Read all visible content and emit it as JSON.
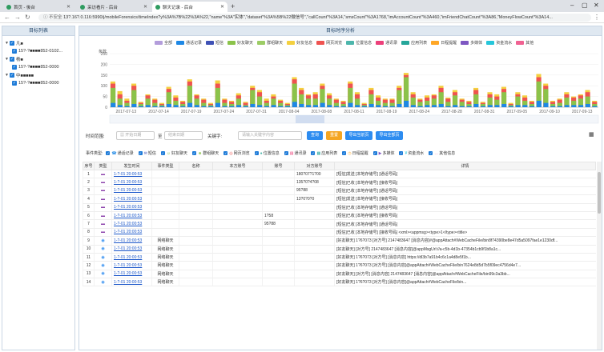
{
  "tabs": [
    {
      "title": "首页 - 後台"
    },
    {
      "title": "采访看片 - 后台"
    },
    {
      "title": "聊天记录 - 后台"
    }
  ],
  "url": "13?.16?.0.116:5990/j/mobileForensics/timeIndex?y%3A%7B%22%3A%22,\"name\"%3A\"实体\",\"dataset\"%3A%5B%22微信号”,\"callCount\"%3A14,\"smsCount\"%3A1768,\"imAccountCount\"%3A460,\"imFriendChatCount\"%3A86,\"MoneyFlowCount\"%3A14...",
  "addr_warn": "不安全",
  "sidebar": {
    "title": "目标列表",
    "items": [
      {
        "label": "凡■",
        "toggle": "▼"
      },
      {
        "label": "15?-?■■■■852-0102..."
      },
      {
        "label": "杨■",
        "toggle": "▼"
      },
      {
        "label": "15?-?■■■■852-0000"
      },
      {
        "label": "中■■■■■",
        "toggle": "▼"
      },
      {
        "label": "15?-?■■■■852-0000"
      }
    ]
  },
  "main": {
    "title": "目标时序分析"
  },
  "legend": [
    {
      "label": "全部",
      "color": "#b39ddb"
    },
    {
      "label": "通话记录",
      "color": "#1e88e5"
    },
    {
      "label": "短信",
      "color": "#3f51b5"
    },
    {
      "label": "好友聊天",
      "color": "#8bc34a"
    },
    {
      "label": "群组聊天",
      "color": "#9ccc65"
    },
    {
      "label": "好友信息",
      "color": "#f4d03f"
    },
    {
      "label": "网页浏览",
      "color": "#ef5350"
    },
    {
      "label": "位置信息",
      "color": "#4db6ac"
    },
    {
      "label": "通讯录",
      "color": "#ec407a"
    },
    {
      "label": "应用列表",
      "color": "#26a69a"
    },
    {
      "label": "日程提醒",
      "color": "#ffa726"
    },
    {
      "label": "多媒体",
      "color": "#7e57c2"
    },
    {
      "label": "资金流水",
      "color": "#26c6da"
    },
    {
      "label": "其他",
      "color": "#f06292"
    }
  ],
  "chart_data": {
    "type": "bar",
    "ylabel": "条数",
    "yticks": [
      0,
      50,
      100,
      150,
      200,
      250
    ],
    "ylim": [
      0,
      250
    ],
    "xticks": [
      "2017-07-13",
      "2017-07-14",
      "2017-07-19",
      "2017-07-24",
      "2017-07-31",
      "2017-08-04",
      "2017-08-08",
      "2017-08-11",
      "2017-08-19",
      "2017-08-24",
      "2017-08-28",
      "2017-08-31",
      "2017-09-05",
      "2017-09-10",
      "2017-09-13"
    ],
    "series": [
      {
        "color": "#f4d03f",
        "values": [
          120,
          75,
          40,
          110,
          25,
          60,
          40,
          20,
          95,
          55,
          30,
          130,
          60,
          40,
          20,
          125,
          40,
          30,
          65,
          25,
          100,
          80,
          40,
          60,
          35,
          20,
          140,
          90,
          60,
          70,
          110,
          65,
          40,
          30,
          120,
          70,
          20,
          90,
          55,
          40,
          40,
          100,
          160,
          70,
          40,
          55,
          60,
          100,
          45,
          80,
          40,
          30,
          90,
          25,
          70,
          60,
          95,
          20,
          70,
          55,
          30,
          155,
          110,
          30,
          40,
          70,
          50,
          60,
          80,
          30
        ]
      },
      {
        "color": "#ef5350",
        "values": [
          110,
          60,
          30,
          100,
          20,
          55,
          35,
          15,
          85,
          45,
          25,
          120,
          55,
          35,
          15,
          110,
          35,
          25,
          55,
          20,
          90,
          70,
          30,
          50,
          30,
          15,
          130,
          80,
          55,
          60,
          100,
          55,
          35,
          25,
          110,
          60,
          15,
          80,
          45,
          35,
          35,
          90,
          150,
          60,
          35,
          45,
          55,
          90,
          40,
          70,
          35,
          25,
          80,
          20,
          60,
          50,
          85,
          15,
          60,
          45,
          25,
          140,
          100,
          25,
          35,
          60,
          45,
          55,
          70,
          25
        ]
      },
      {
        "color": "#8bc34a",
        "values": [
          90,
          40,
          20,
          80,
          15,
          40,
          20,
          10,
          70,
          30,
          15,
          100,
          40,
          20,
          10,
          90,
          20,
          15,
          40,
          10,
          80,
          50,
          20,
          40,
          20,
          10,
          110,
          60,
          40,
          40,
          85,
          40,
          20,
          15,
          90,
          40,
          10,
          60,
          30,
          20,
          20,
          80,
          140,
          45,
          25,
          30,
          40,
          70,
          25,
          55,
          25,
          15,
          60,
          15,
          45,
          35,
          70,
          10,
          50,
          30,
          15,
          120,
          85,
          15,
          20,
          45,
          30,
          40,
          50,
          15
        ]
      },
      {
        "color": "#1e88e5",
        "values": [
          20,
          10,
          5,
          15,
          5,
          10,
          5,
          5,
          15,
          10,
          5,
          20,
          10,
          5,
          5,
          20,
          5,
          5,
          10,
          5,
          15,
          10,
          5,
          10,
          5,
          5,
          25,
          15,
          10,
          10,
          20,
          10,
          5,
          5,
          20,
          10,
          5,
          15,
          10,
          5,
          5,
          15,
          30,
          10,
          5,
          10,
          10,
          15,
          5,
          10,
          5,
          5,
          15,
          5,
          10,
          10,
          15,
          5,
          10,
          10,
          5,
          30,
          20,
          5,
          5,
          10,
          10,
          10,
          15,
          5
        ]
      }
    ]
  },
  "filters": {
    "time_label": "时间范围:",
    "start_placeholder": "开始日期",
    "sep": "至",
    "end_placeholder": "结束日期",
    "keyword_label": "关键字:",
    "keyword_placeholder": "请输入关键字内容",
    "btn_search": "查询",
    "btn_reset": "重置",
    "btn_export": "导出当前页",
    "btn_export_all": "导出全部页"
  },
  "types_label": "事件类型:",
  "types": [
    {
      "label": "通话记录",
      "icon": "☎",
      "color": "#1e88e5"
    },
    {
      "label": "短信",
      "icon": "✉",
      "color": "#3f51b5"
    },
    {
      "label": "好友聊天",
      "icon": "☺",
      "color": "#8bc34a"
    },
    {
      "label": "群组聊天",
      "icon": "☻",
      "color": "#9ccc65"
    },
    {
      "label": "网页浏览",
      "icon": "◎",
      "color": "#ef5350"
    },
    {
      "label": "位置信息",
      "icon": "●",
      "color": "#4db6ac"
    },
    {
      "label": "通讯录",
      "icon": "▤",
      "color": "#ec407a"
    },
    {
      "label": "应用列表",
      "icon": "▦",
      "color": "#26a69a"
    },
    {
      "label": "日程提醒",
      "icon": "◷",
      "color": "#ffa726"
    },
    {
      "label": "多媒体",
      "icon": "▶",
      "color": "#7e57c2"
    },
    {
      "label": "资金流水",
      "icon": "¥",
      "color": "#26c6da"
    },
    {
      "label": "其他信息",
      "icon": "…",
      "color": "#f06292"
    }
  ],
  "table": {
    "headers": [
      "序号",
      "类型",
      "发生时间",
      "事件类型",
      "名称",
      "本方账号",
      "账号",
      "对方账号",
      "详情"
    ],
    "rows": [
      [
        "1",
        "msg",
        "1-?-01 20:00:53",
        "",
        "",
        "",
        "",
        "180?07?1?00",
        "[短信]发送 [本地存储号] [通话号码]"
      ],
      [
        "2",
        "msg",
        "1-?-01 20:00:53",
        "",
        "",
        "",
        "",
        "135?0?4?08",
        "[短信]已收 [本地存储号] [接收号码]"
      ],
      [
        "3",
        "msg",
        "1-?-01 20:00:53",
        "",
        "",
        "",
        "",
        "95?88",
        "[短信]已收 [本地存储号] [通话号码]"
      ],
      [
        "4",
        "msg",
        "1-?-01 20:00:53",
        "",
        "",
        "",
        "",
        "13?0?0?0",
        "[短信]发送 [本地存储号] [接收号码]"
      ],
      [
        "5",
        "msg",
        "1-?-01 20:00:53",
        "",
        "",
        "",
        "",
        "",
        "[短信]已收 [本地存储号] [通话号码]"
      ],
      [
        "6",
        "msg",
        "1-?-01 20:00:53",
        "",
        "",
        "",
        "1?58",
        "",
        "[短信]已收 [本地存储号] [接收号码]"
      ],
      [
        "7",
        "msg",
        "1-?-01 20:00:53",
        "",
        "",
        "",
        "95?88",
        "",
        "[短信]已收 [本地存储号] [通话号码]"
      ],
      [
        "8",
        "msg",
        "1-?-01 20:00:53",
        "",
        "",
        "",
        "",
        "",
        "[短信]已收 [本地存储号] [接收号码] <xml><appmsg><type>1</type><title>"
      ],
      [
        "9",
        "chat",
        "1-?-01 20:00:53",
        "网络聊天",
        "",
        "",
        "",
        "",
        "[好友聊天] 1?6?073 [对方号] 2147483647 [消息内容]#@appAttach#WebCacheFile/bin8f74390be8e47d5a5097fae1e1230df..."
      ],
      [
        "10",
        "chat",
        "1-?-01 20:00:53",
        "网络聊天",
        "",
        "",
        "",
        "",
        "[好友聊天] [对方号] 2147483647 [消息内容]@appMsgUrl://a-c5b-4d1b-47354b1cb9f1b8a1c..."
      ],
      [
        "11",
        "chat",
        "1-?-01 20:00:53",
        "网络聊天",
        "",
        "",
        "",
        "",
        "[好友聊天] 1?6?073 [对方号] [消息内容] https://dl3b7a91b4c6c1a4d8e5f1b..."
      ],
      [
        "12",
        "chat",
        "1-?-01 20:00:53",
        "网络聊天",
        "",
        "",
        "",
        "",
        "[好友聊天] 1?6?073 [对方号] [消息内容]@appAttach#WebCacheFile/bin7624e8d5d7b5f09ec4756d4e7..."
      ],
      [
        "13",
        "chat",
        "1-?-01 20:00:53",
        "网络聊天",
        "",
        "",
        "",
        "",
        "[好友聊天] [对方号] [消息内容] 2147483647 [消息内容]@appAttach#WebCacheFile/bin99c3a3bb..."
      ],
      [
        "14",
        "chat",
        "1-?-01 20:00:53",
        "网络聊天",
        "",
        "",
        "",
        "",
        "[好友聊天] 1?6?073 [对方号] [消息内容]@appAttach#WebCacheFile/bin..."
      ]
    ]
  }
}
